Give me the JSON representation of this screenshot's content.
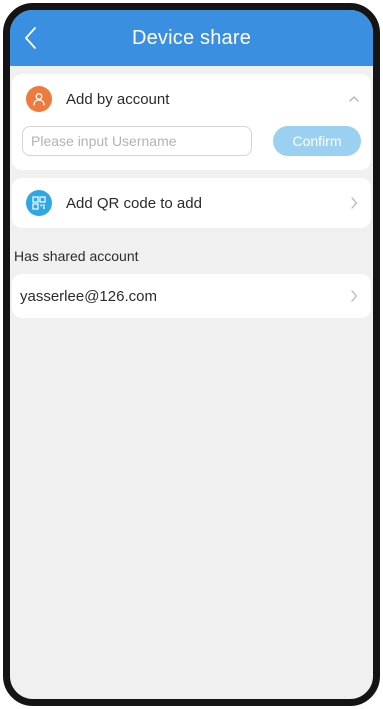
{
  "header": {
    "title": "Device share",
    "back_icon": "chevron-left-icon"
  },
  "add_by_account": {
    "label": "Add by account",
    "icon": "user-icon",
    "icon_color": "#ee7a3f",
    "toggle_icon": "chevron-up-icon",
    "input_placeholder": "Please input Username",
    "input_value": "",
    "confirm_label": "Confirm"
  },
  "add_qr": {
    "label": "Add QR code to add",
    "icon": "qr-code-icon",
    "icon_color": "#2fa7e6",
    "chevron_icon": "chevron-right-icon"
  },
  "shared": {
    "section_title": "Has shared account",
    "accounts": [
      {
        "label": "yasserlee@126.com"
      }
    ]
  },
  "colors": {
    "accent": "#3a8fe0",
    "confirm_disabled": "#9bd0f1",
    "background": "#f0f0f0"
  }
}
